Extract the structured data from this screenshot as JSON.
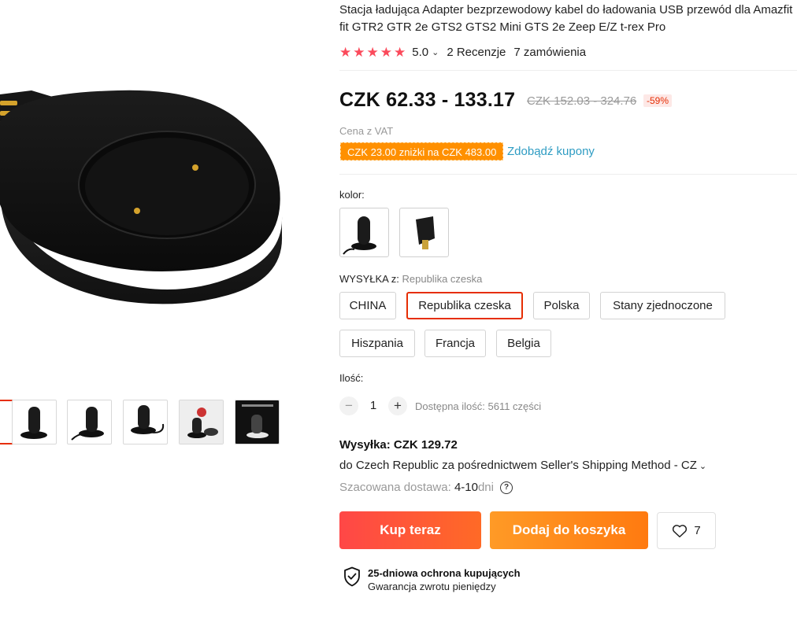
{
  "product": {
    "title_line1": "Stacja ładująca Adapter bezprzewodowy kabel do ładowania USB przewód dla Amazfit",
    "title_line2": "fit GTR2 GTR 2e GTS2 GTS2 Mini GTS 2e Zeep E/Z t-rex Pro"
  },
  "rating": {
    "stars": 5,
    "score": "5.0",
    "reviews": "2 Recenzje",
    "orders": "7 zamówienia"
  },
  "price": {
    "current": "CZK 62.33 - 133.17",
    "original": "CZK 152.03 - 324.76",
    "discount": "-59%",
    "vat_note": "Cena z VAT"
  },
  "coupon": {
    "badge": "CZK 23.00 zniżki na CZK 483.00",
    "link": "Zdobądź kupony"
  },
  "color": {
    "label": "kolor:"
  },
  "shipping_from": {
    "label": "WYSYŁKA z:",
    "value": "Republika czeska",
    "options": [
      "CHINA",
      "Republika czeska",
      "Polska",
      "Stany zjednoczone",
      "Hiszpania",
      "Francja",
      "Belgia"
    ],
    "selected": "Republika czeska"
  },
  "quantity": {
    "label": "Ilość:",
    "value": "1",
    "minus": "−",
    "plus": "+",
    "available": "Dostępna ilość: 5611 części"
  },
  "delivery": {
    "cost": "Wysyłka: CZK 129.72",
    "to": "do Czech Republic za pośrednictwem Seller's Shipping Method - CZ",
    "est_label": "Szacowana dostawa:",
    "est_value": "4-10",
    "est_unit": "dni"
  },
  "actions": {
    "buy_now": "Kup teraz",
    "add_to_cart": "Dodaj do koszyka",
    "wishlist_count": "7"
  },
  "protection": {
    "title": "25-dniowa ochrona kupujących",
    "subtitle": "Gwarancja zwrotu pieniędzy"
  },
  "icons": {
    "rating_chevron": "chevron-down-icon",
    "help": "help-icon",
    "heart": "heart-icon",
    "shield": "shield-check-icon"
  },
  "colors": {
    "accent_red": "#e62e04",
    "star": "#fb4a5b",
    "coupon": "#ff9000",
    "link": "#2e9cc3"
  }
}
